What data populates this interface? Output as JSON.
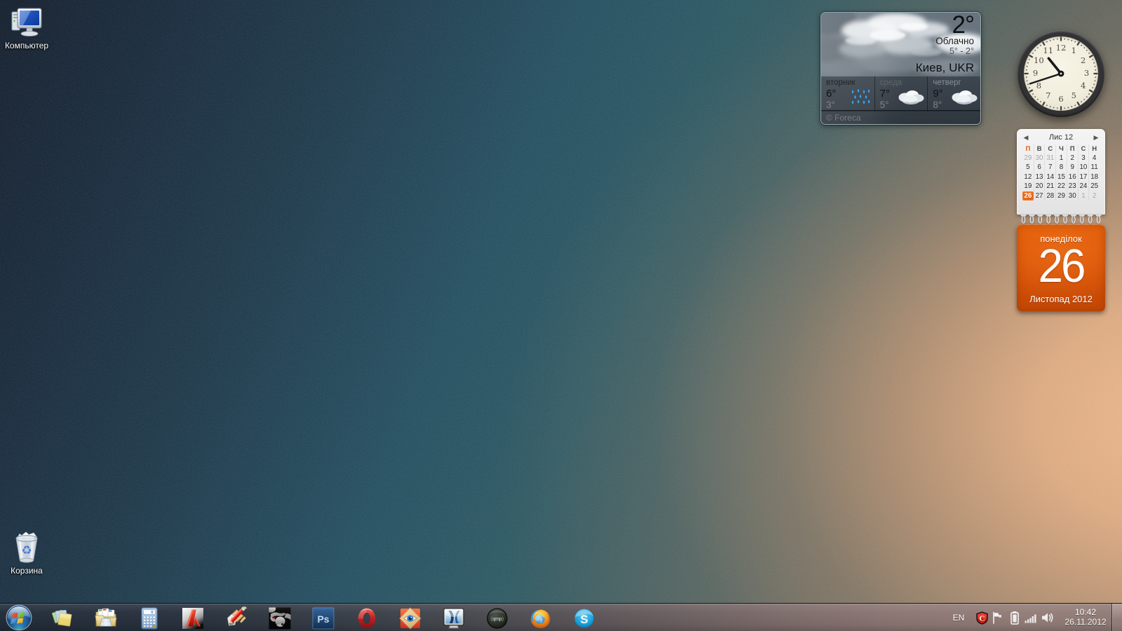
{
  "desktop": {
    "icons": [
      {
        "name": "computer",
        "label": "Компьютер"
      },
      {
        "name": "recycle-bin",
        "label": "Корзина"
      }
    ]
  },
  "weather": {
    "current_temp": "2°",
    "condition": "Облачно",
    "range": "5° - 2°",
    "location": "Киев, UKR",
    "attribution": "© Foreca",
    "forecast": [
      {
        "day": "вторник",
        "high": "6°",
        "low": "3°",
        "icon": "rain"
      },
      {
        "day": "среда",
        "high": "7°",
        "low": "5°",
        "icon": "clouds"
      },
      {
        "day": "четверг",
        "high": "9°",
        "low": "8°",
        "icon": "clouds"
      }
    ]
  },
  "clock": {
    "hours": 10,
    "minutes": 42,
    "numerals": [
      "1",
      "2",
      "3",
      "4",
      "5",
      "6",
      "7",
      "8",
      "9",
      "10",
      "11",
      "12"
    ]
  },
  "calendar": {
    "month_label": "Лис 12",
    "prev_arrow": "◀",
    "next_arrow": "▶",
    "weekday_headers": [
      "П",
      "В",
      "С",
      "Ч",
      "П",
      "С",
      "Н"
    ],
    "weeks": [
      [
        {
          "d": "29",
          "muted": true
        },
        {
          "d": "30",
          "muted": true
        },
        {
          "d": "31",
          "muted": true
        },
        {
          "d": "1"
        },
        {
          "d": "2"
        },
        {
          "d": "3"
        },
        {
          "d": "4"
        }
      ],
      [
        {
          "d": "5"
        },
        {
          "d": "6"
        },
        {
          "d": "7"
        },
        {
          "d": "8"
        },
        {
          "d": "9"
        },
        {
          "d": "10"
        },
        {
          "d": "11"
        }
      ],
      [
        {
          "d": "12"
        },
        {
          "d": "13"
        },
        {
          "d": "14"
        },
        {
          "d": "15"
        },
        {
          "d": "16"
        },
        {
          "d": "17"
        },
        {
          "d": "18"
        }
      ],
      [
        {
          "d": "19"
        },
        {
          "d": "20"
        },
        {
          "d": "21"
        },
        {
          "d": "22"
        },
        {
          "d": "23"
        },
        {
          "d": "24"
        },
        {
          "d": "25"
        }
      ],
      [
        {
          "d": "26",
          "today": true
        },
        {
          "d": "27"
        },
        {
          "d": "28"
        },
        {
          "d": "29"
        },
        {
          "d": "30"
        },
        {
          "d": "1",
          "muted": true
        },
        {
          "d": "2",
          "muted": true
        }
      ]
    ],
    "tearoff": {
      "weekday": "понеділок",
      "day": "26",
      "month_year": "Листопад 2012"
    },
    "accent_color": "#e8620e"
  },
  "taskbar": {
    "apps": [
      {
        "name": "sticky-notes"
      },
      {
        "name": "windows-explorer"
      },
      {
        "name": "calculator"
      },
      {
        "name": "autocad"
      },
      {
        "name": "sketch-pencil"
      },
      {
        "name": "rhinoceros"
      },
      {
        "name": "photoshop"
      },
      {
        "name": "opera"
      },
      {
        "name": "faststone-viewer"
      },
      {
        "name": "monitor-app"
      },
      {
        "name": "qmp-player"
      },
      {
        "name": "firefox"
      },
      {
        "name": "skype"
      }
    ],
    "tray": {
      "language": "EN",
      "time": "10:42",
      "date": "26.11.2012",
      "icons": [
        "comodo-shield",
        "action-center-flag",
        "battery",
        "network-signal",
        "volume"
      ]
    }
  }
}
